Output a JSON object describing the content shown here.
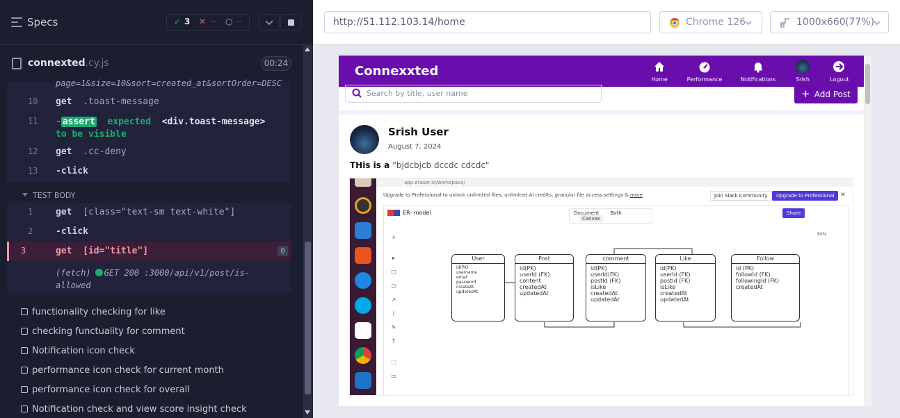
{
  "runner": {
    "specs_label": "Specs",
    "passed_count": "3",
    "failed_count": "--",
    "pending_count": "--",
    "file_name": "connexted",
    "file_ext": ".cy.js",
    "timer": "00:24",
    "url_fragment": "page=1&size=10&sort=created_at&sortOrder=DESC",
    "commands": [
      {
        "num": "10",
        "cmd": "get",
        "arg": ".toast-message"
      },
      {
        "num": "11",
        "tag": "assert",
        "text_a": "expected",
        "arg": "<div.toast-message>",
        "text_b": "to be",
        "text_c": "visible"
      },
      {
        "num": "12",
        "cmd": "get",
        "arg": ".cc-deny"
      },
      {
        "num": "13",
        "cmd": "-click",
        "arg": ""
      }
    ],
    "test_body_label": "TEST BODY",
    "body_commands": [
      {
        "num": "1",
        "cmd": "get",
        "arg": "[class=\"text-sm text-white\"]"
      },
      {
        "num": "2",
        "cmd": "-click",
        "arg": ""
      },
      {
        "num": "3",
        "cmd": "get",
        "arg": "[id=\"title\"]",
        "badge": "0"
      }
    ],
    "fetch_line1": "(fetch)",
    "fetch_line2": "GET 200 :3000/api/v1/post/is-",
    "fetch_line3": "allowed",
    "tests": [
      "functionality checking for like",
      "checking functuality for comment",
      "Notification icon check",
      "performance icon check for current month",
      "performance icon check for overall",
      "Notification check and view score insight check"
    ]
  },
  "browser": {
    "url": "http://51.112.103.14/home",
    "browser_name": "Chrome 126",
    "viewport": "1000x660",
    "zoom": "(77%)"
  },
  "app": {
    "brand": "Connexxted",
    "nav": [
      {
        "label": "Home",
        "icon": "home-icon"
      },
      {
        "label": "Performance",
        "icon": "gauge-icon"
      },
      {
        "label": "Notifications",
        "icon": "bell-icon"
      },
      {
        "label": "Srish",
        "icon": "avatar"
      },
      {
        "label": "Logout",
        "icon": "logout-icon"
      }
    ],
    "search_placeholder": "Search by title, user name",
    "add_post": "Add Post",
    "post": {
      "user": "Srish User",
      "date": "August 7, 2024",
      "text_bold": "THis is a ",
      "text_quote": "\"bjdcbjcb dccdc cdcdc\""
    }
  },
  "screenshot": {
    "address": "app.eraser.io/workspace/",
    "banner": "Upgrade to Professional to unlock unlimited files, unlimited AI credits, granular file access settings &",
    "banner_link": "more",
    "join_slack": "Join Slack Community",
    "upgrade": "Upgrade to Professional",
    "doc_title": "ER- model",
    "tabs": [
      "Document",
      "Both",
      "Canvas"
    ],
    "share": "Share",
    "zoom": "80%",
    "tables": [
      {
        "name": "User",
        "fields": [
          "id(PK)",
          "username",
          "email",
          "password",
          "createAt",
          "updatedAt"
        ]
      },
      {
        "name": "Post",
        "fields": [
          "id(PK)",
          "userId (FK)",
          "content",
          "createdAt",
          "updatedAt"
        ]
      },
      {
        "name": "comment",
        "fields": [
          "id(PK)",
          "userId(FK)",
          "postId (FK)",
          "isLike",
          "createdAt",
          "updatedAt"
        ]
      },
      {
        "name": "Like",
        "fields": [
          "id(PK)",
          "userId (FK)",
          "postId (FK)",
          "isLike",
          "createdAt",
          "updatedAt"
        ]
      },
      {
        "name": "Follow",
        "fields": [
          "id (PK)",
          "followId (FK)",
          "followingId (FK)",
          "createdAt"
        ]
      }
    ]
  },
  "colors": {
    "brand_purple": "#6a0dad",
    "pass_green": "#1fa971",
    "fail_red": "#f59aa9"
  }
}
